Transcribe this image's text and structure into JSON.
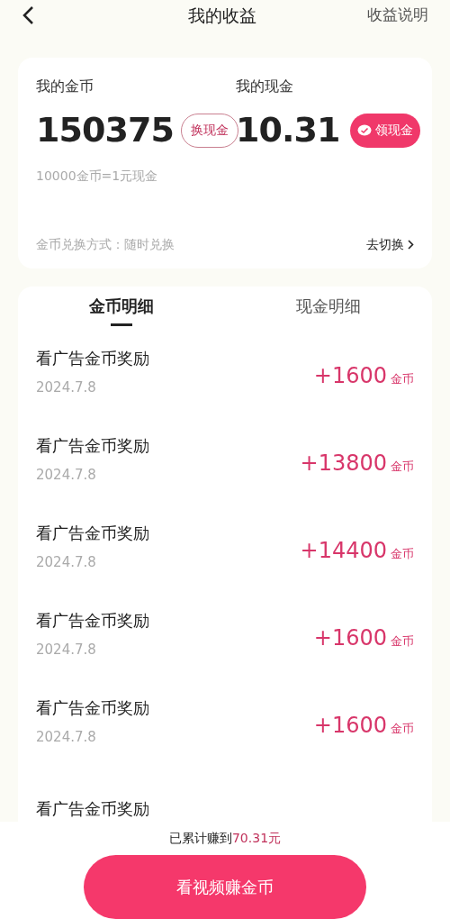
{
  "header": {
    "title": "我的收益",
    "action": "收益说明"
  },
  "balance": {
    "coins_label": "我的金币",
    "coins": "150375",
    "exchange_button": "换现金",
    "cash_label": "我的现金",
    "cash": "10.31",
    "withdraw_button": "领现金",
    "rate": "10000金币=1元现金",
    "method": "金币兑换方式：随时兑换",
    "switch_link": "去切换"
  },
  "tabs": [
    {
      "label": "金币明细",
      "selected": true
    },
    {
      "label": "现金明细",
      "selected": false
    }
  ],
  "records": [
    {
      "title": "看广告金币奖励",
      "date": "2024.7.8",
      "amount": "+1600",
      "unit": "金币"
    },
    {
      "title": "看广告金币奖励",
      "date": "2024.7.8",
      "amount": "+13800",
      "unit": "金币"
    },
    {
      "title": "看广告金币奖励",
      "date": "2024.7.8",
      "amount": "+14400",
      "unit": "金币"
    },
    {
      "title": "看广告金币奖励",
      "date": "2024.7.8",
      "amount": "+1600",
      "unit": "金币"
    },
    {
      "title": "看广告金币奖励",
      "date": "2024.7.8",
      "amount": "+1600",
      "unit": "金币"
    },
    {
      "title": "看广告金币奖励"
    }
  ],
  "footer": {
    "total_prefix": "已累计赚到",
    "total_amount": "70.31元",
    "cta": "看视频赚金币"
  }
}
